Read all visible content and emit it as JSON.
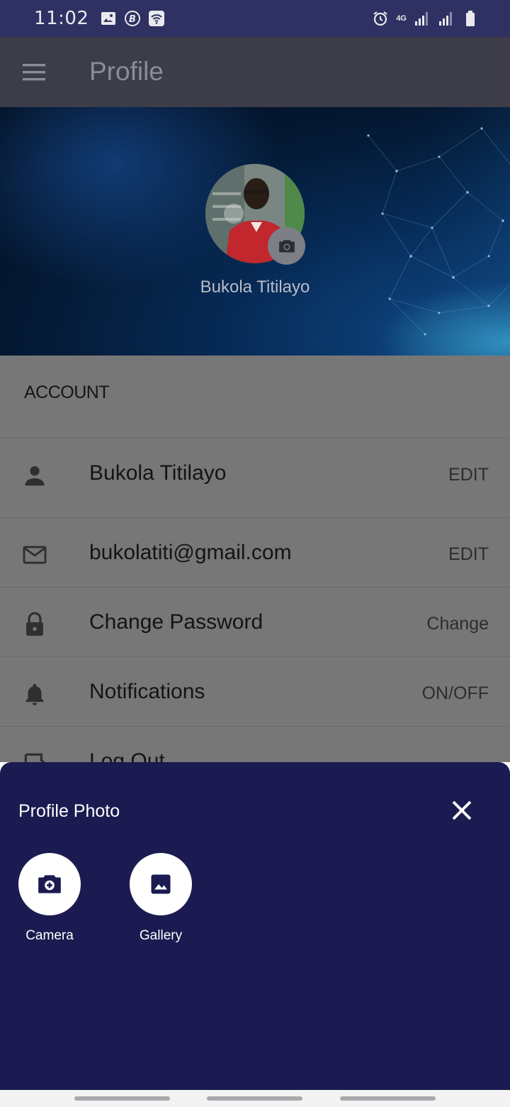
{
  "status_bar": {
    "time": "11:02",
    "network": "4G"
  },
  "app_bar": {
    "title": "Profile"
  },
  "hero": {
    "user_name": "Bukola Titilayo"
  },
  "account": {
    "section_title": "ACCOUNT",
    "rows": [
      {
        "icon": "person-icon",
        "label": "Bukola Titilayo",
        "action": "EDIT"
      },
      {
        "icon": "mail-icon",
        "label": "bukolatiti@gmail.com",
        "action": "EDIT"
      },
      {
        "icon": "lock-icon",
        "label": "Change Password",
        "action": "Change"
      },
      {
        "icon": "bell-icon",
        "label": "Notifications",
        "action": "ON/OFF"
      },
      {
        "icon": "logout-icon",
        "label": "Log Out",
        "action": ""
      }
    ]
  },
  "bottom_sheet": {
    "title": "Profile Photo",
    "options": [
      {
        "icon": "camera-icon",
        "label": "Camera"
      },
      {
        "icon": "gallery-icon",
        "label": "Gallery"
      }
    ]
  },
  "colors": {
    "status_bar": "#2f3163",
    "app_bar": "#3d3d49",
    "sheet_background": "#1b1b51",
    "scrim_content": "#777777"
  }
}
